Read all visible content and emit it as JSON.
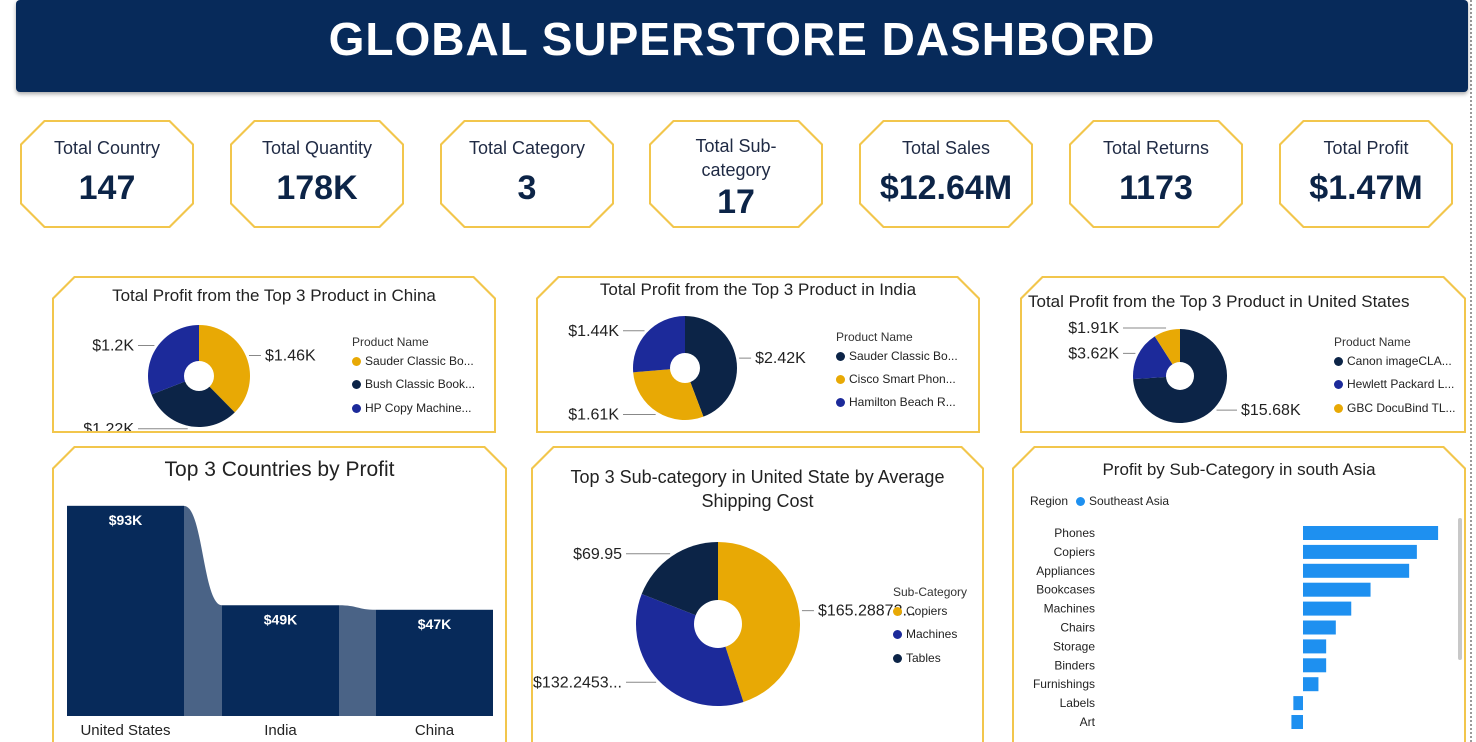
{
  "header": {
    "title": "GLOBAL SUPERSTORE DASHBORD"
  },
  "colors": {
    "navy": "#072a5a",
    "dark": "#0c2447",
    "gold": "#e8a905",
    "blue": "#1c2a9a",
    "accent": "#f2c64c",
    "bar": "#1e90f0",
    "connector": "#4a6386"
  },
  "kpis": [
    {
      "label": "Total Country",
      "value": "147"
    },
    {
      "label": "Total Quantity",
      "value": "178K"
    },
    {
      "label": "Total Category",
      "value": "3"
    },
    {
      "label": "Total Sub-category",
      "value": "17"
    },
    {
      "label": "Total Sales",
      "value": "$12.64M"
    },
    {
      "label": "Total Returns",
      "value": "1173"
    },
    {
      "label": "Total Profit",
      "value": "$1.47M"
    }
  ],
  "chart_data": [
    {
      "type": "pie",
      "title": "Total Profit from the Top 3 Product in China",
      "legend_title": "Product Name",
      "categories": [
        "Sauder Classic Bo...",
        "Bush Classic Book...",
        "HP Copy Machine..."
      ],
      "values": [
        1.46,
        1.22,
        1.2
      ],
      "data_labels": [
        "$1.46K",
        "$1.22K",
        "$1.2K"
      ],
      "colors": [
        "#e8a905",
        "#0c2447",
        "#1c2a9a"
      ],
      "legend_position": "right"
    },
    {
      "type": "pie",
      "title": "Total Profit from the Top 3 Product in India",
      "legend_title": "Product Name",
      "categories": [
        "Sauder Classic Bo...",
        "Cisco Smart Phon...",
        "Hamilton Beach R..."
      ],
      "values": [
        2.42,
        1.61,
        1.44
      ],
      "data_labels": [
        "$2.42K",
        "$1.61K",
        "$1.44K"
      ],
      "colors": [
        "#0c2447",
        "#e8a905",
        "#1c2a9a"
      ],
      "legend_position": "right"
    },
    {
      "type": "pie",
      "title": "Total Profit from the Top 3 Product in United States",
      "legend_title": "Product Name",
      "categories": [
        "Canon imageCLA...",
        "Hewlett Packard L...",
        "GBC DocuBind TL..."
      ],
      "values": [
        15.68,
        3.62,
        1.91
      ],
      "data_labels": [
        "$15.68K",
        "$3.62K",
        "$1.91K"
      ],
      "colors": [
        "#0c2447",
        "#1c2a9a",
        "#e8a905"
      ],
      "legend_position": "right"
    },
    {
      "type": "bar",
      "title": "Top 3 Countries by Profit",
      "categories": [
        "United States",
        "India",
        "China"
      ],
      "values": [
        93,
        49,
        47
      ],
      "data_labels": [
        "$93K",
        "$49K",
        "$47K"
      ],
      "colors": [
        "#072a5a"
      ]
    },
    {
      "type": "pie",
      "title": "Top 3 Sub-category in United State by Average Shipping Cost",
      "legend_title": "Sub-Category",
      "categories": [
        "Copiers",
        "Machines",
        "Tables"
      ],
      "values": [
        165.28873,
        132.2453,
        69.95
      ],
      "data_labels": [
        "$165.28873...",
        "$132.2453...",
        "$69.95"
      ],
      "colors": [
        "#e8a905",
        "#1c2a9a",
        "#0c2447"
      ],
      "legend_position": "right"
    },
    {
      "type": "bar",
      "orientation": "horizontal",
      "title": "Profit by Sub-Category in south Asia",
      "legend_title": "Region",
      "series": [
        {
          "name": "Southeast Asia",
          "values": [
            7.0,
            5.9,
            5.5,
            3.5,
            2.5,
            1.7,
            1.2,
            1.2,
            0.8,
            -0.5,
            -0.6
          ]
        }
      ],
      "categories": [
        "Phones",
        "Copiers",
        "Appliances",
        "Bookcases",
        "Machines",
        "Chairs",
        "Storage",
        "Binders",
        "Furnishings",
        "Labels",
        "Art"
      ],
      "colors": [
        "#1e90f0"
      ]
    }
  ]
}
